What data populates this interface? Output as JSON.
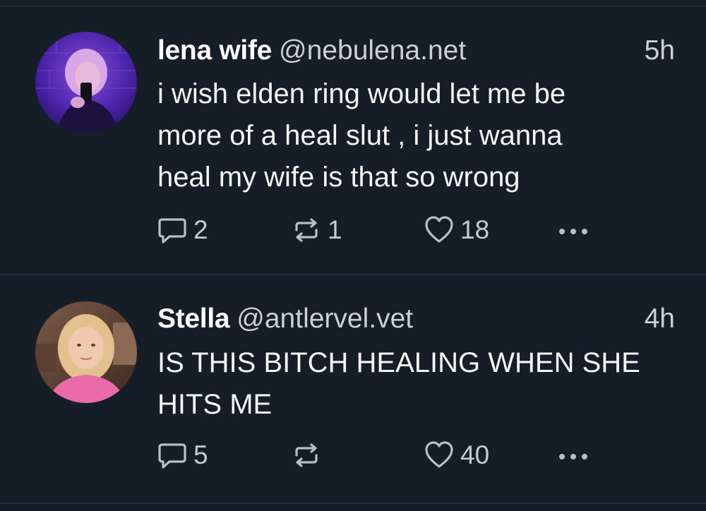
{
  "posts": [
    {
      "display_name": "lena wife",
      "handle": "@nebulena.net",
      "time": "5h",
      "text_lines": [
        "i wish elden ring would let me be",
        "more of a heal slut , i just wanna",
        "heal my wife is that so wrong"
      ],
      "replies": "2",
      "reposts": "1",
      "likes": "18",
      "avatar_colors": [
        "#3a1f8c",
        "#7a3fd6",
        "#c04fd1"
      ]
    },
    {
      "display_name": "Stella",
      "handle": "@antlervel.vet",
      "time": "4h",
      "text_lines": [
        "IS THIS BITCH HEALING WHEN SHE",
        "HITS ME"
      ],
      "replies": "5",
      "reposts": "",
      "likes": "40",
      "avatar_colors": [
        "#6b4a3a",
        "#d9b48a",
        "#e96aa4"
      ]
    }
  ],
  "icons": {
    "reply": "reply-icon",
    "repost": "repost-icon",
    "like": "heart-icon",
    "more": "more-options-icon"
  }
}
